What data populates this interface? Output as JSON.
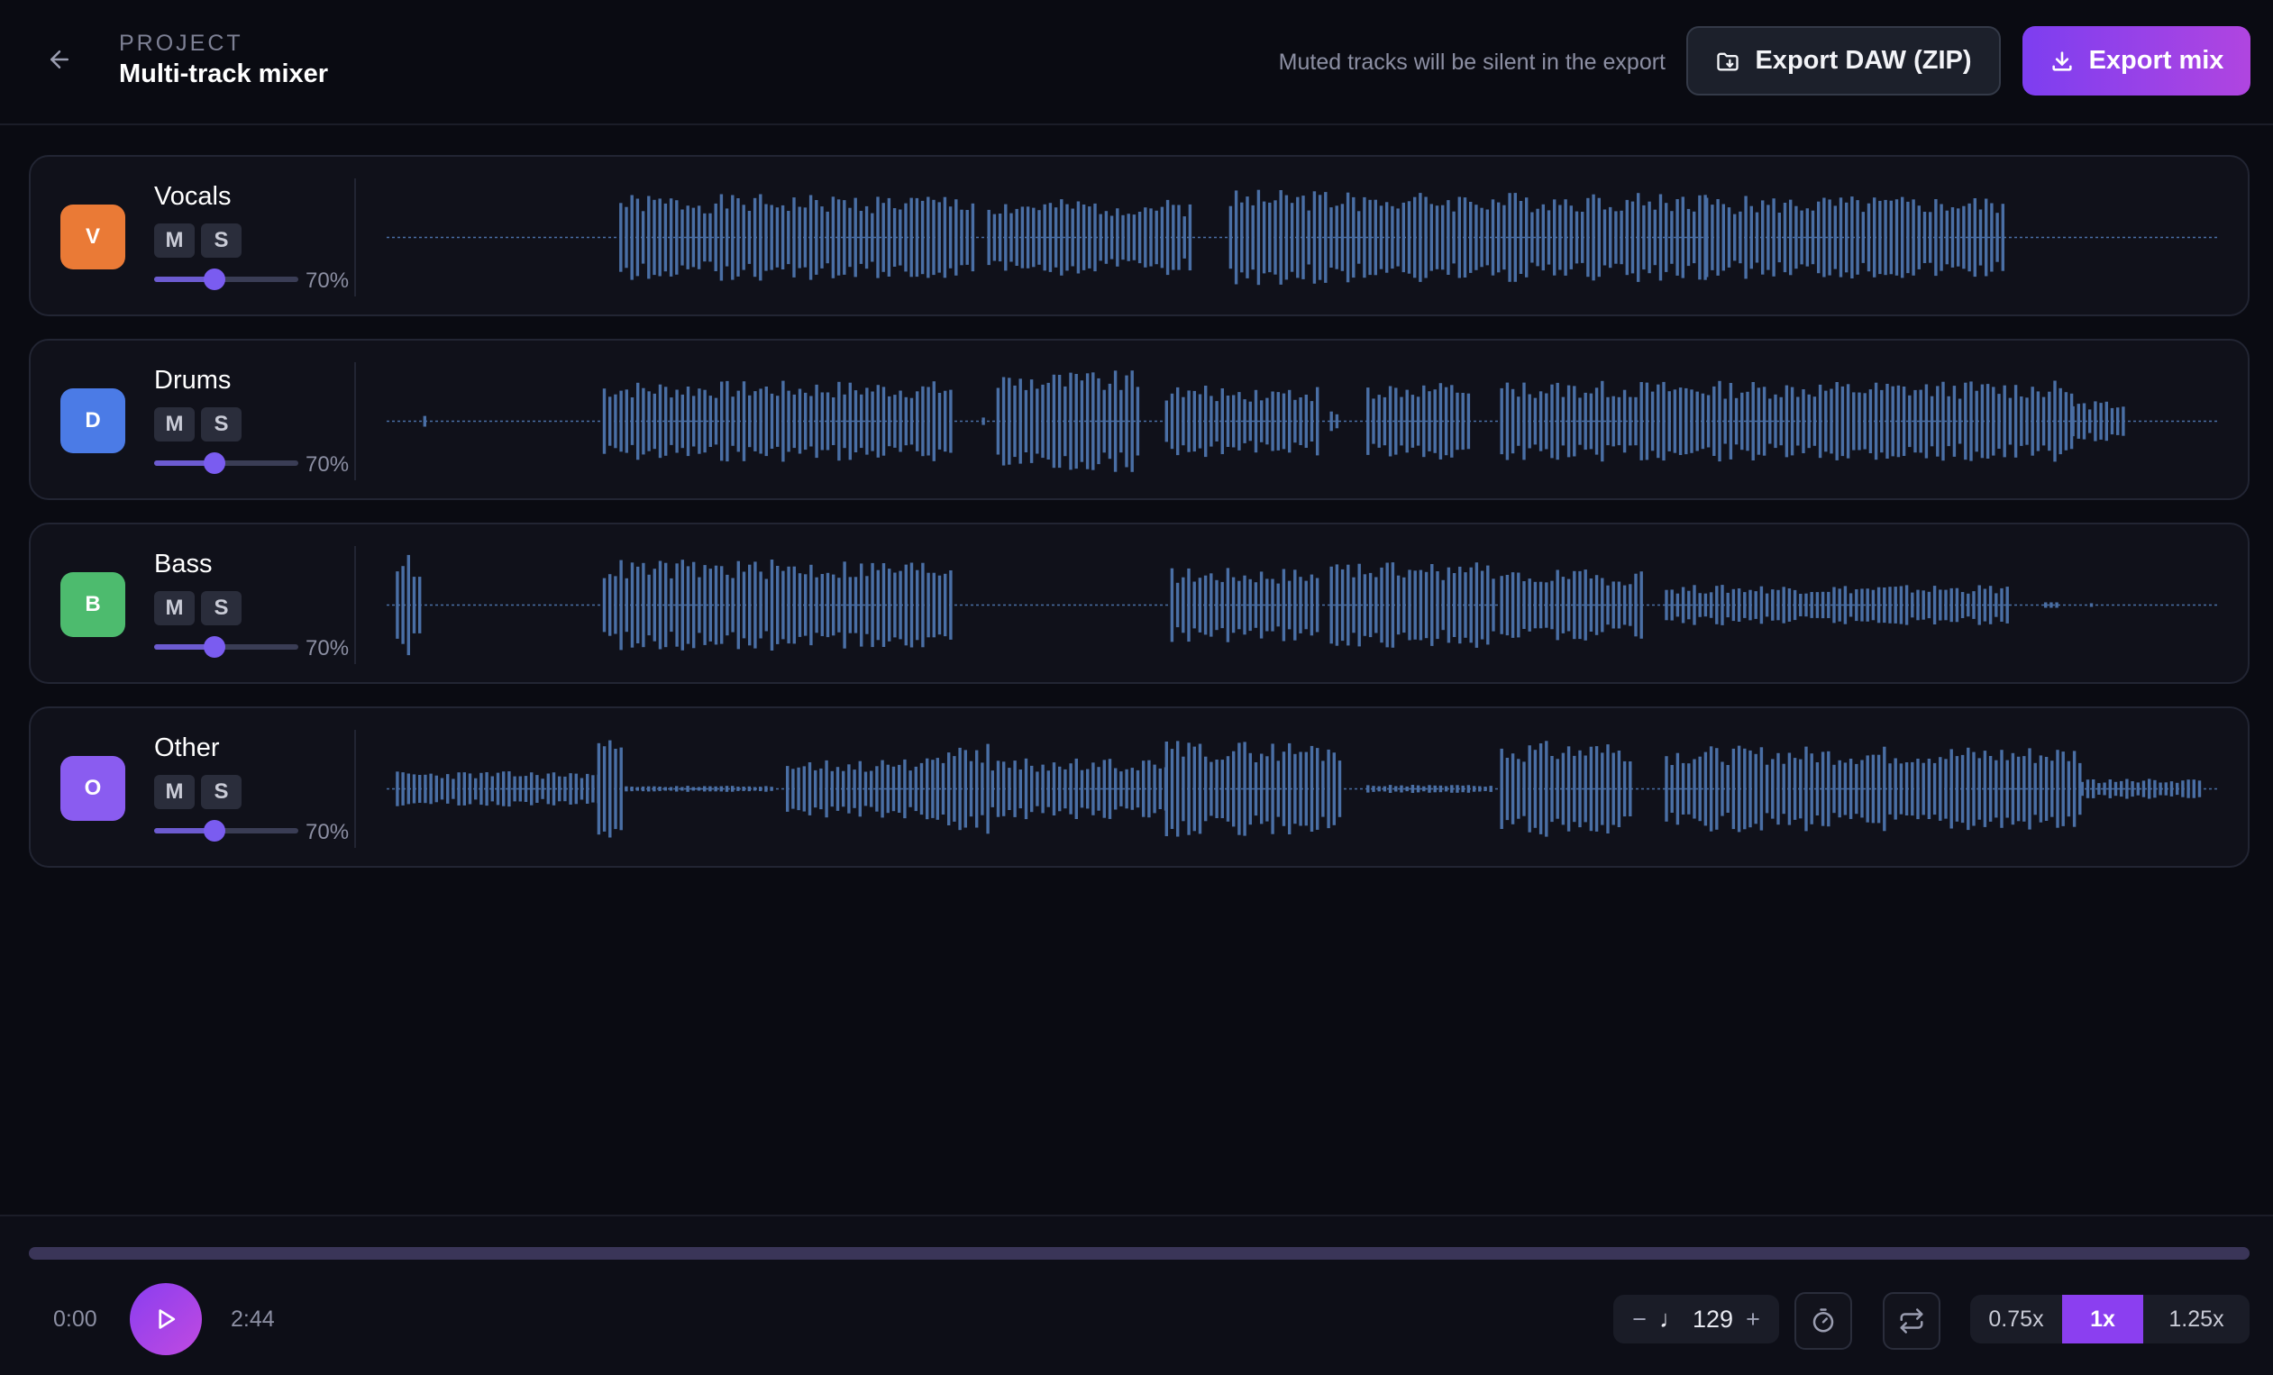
{
  "header": {
    "project_label": "PROJECT",
    "project_title": "Multi-track mixer",
    "export_note": "Muted tracks will be silent in the export",
    "export_daw_label": "Export DAW (ZIP)",
    "export_mix_label": "Export mix",
    "icons": {
      "back": "arrow-left-icon",
      "daw": "folder-download-icon",
      "mix": "download-icon"
    }
  },
  "tracks": [
    {
      "initial": "V",
      "name": "Vocals",
      "mute_label": "M",
      "solo_label": "S",
      "volume": 0.7,
      "volume_label": "70%",
      "color": "#ea7a36",
      "wave_color": "#4a6fa5",
      "segments": [
        [
          0.127,
          0.32,
          0.85,
          1
        ],
        [
          0.328,
          0.44,
          0.75,
          2
        ],
        [
          0.46,
          0.53,
          0.95,
          3
        ],
        [
          0.53,
          0.72,
          0.9,
          4
        ],
        [
          0.72,
          0.883,
          0.82,
          5
        ]
      ]
    },
    {
      "initial": "D",
      "name": "Drums",
      "mute_label": "M",
      "solo_label": "S",
      "volume": 0.7,
      "volume_label": "70%",
      "color": "#4b7be6",
      "wave_color": "#4a6fa5",
      "segments": [
        [
          0.02,
          0.022,
          0.12,
          6
        ],
        [
          0.118,
          0.31,
          0.8,
          7
        ],
        [
          0.325,
          0.328,
          0.1,
          8
        ],
        [
          0.333,
          0.41,
          1.0,
          9
        ],
        [
          0.425,
          0.51,
          0.7,
          10
        ],
        [
          0.515,
          0.52,
          0.2,
          11
        ],
        [
          0.535,
          0.59,
          0.75,
          12
        ],
        [
          0.608,
          0.92,
          0.8,
          13
        ],
        [
          0.92,
          0.95,
          0.4,
          14
        ]
      ]
    },
    {
      "initial": "B",
      "name": "Bass",
      "mute_label": "M",
      "solo_label": "S",
      "volume": 0.7,
      "volume_label": "70%",
      "color": "#4dbb6e",
      "wave_color": "#4a6fa5",
      "segments": [
        [
          0.005,
          0.02,
          1.0,
          15
        ],
        [
          0.118,
          0.31,
          0.9,
          16
        ],
        [
          0.428,
          0.51,
          0.75,
          17
        ],
        [
          0.515,
          0.605,
          0.85,
          18
        ],
        [
          0.608,
          0.685,
          0.7,
          19
        ],
        [
          0.698,
          0.885,
          0.4,
          20
        ],
        [
          0.905,
          0.912,
          0.08,
          21
        ],
        [
          0.93,
          0.932,
          0.06,
          22
        ]
      ]
    },
    {
      "initial": "O",
      "name": "Other",
      "mute_label": "M",
      "solo_label": "S",
      "volume": 0.7,
      "volume_label": "70%",
      "color": "#8a5cf0",
      "wave_color": "#4a6fa5",
      "segments": [
        [
          0.005,
          0.115,
          0.35,
          23
        ],
        [
          0.115,
          0.128,
          1.0,
          24
        ],
        [
          0.13,
          0.21,
          0.06,
          25
        ],
        [
          0.218,
          0.3,
          0.6,
          26
        ],
        [
          0.3,
          0.33,
          0.9,
          27
        ],
        [
          0.33,
          0.425,
          0.6,
          28
        ],
        [
          0.425,
          0.52,
          0.95,
          29
        ],
        [
          0.535,
          0.605,
          0.08,
          30
        ],
        [
          0.608,
          0.68,
          0.95,
          31
        ],
        [
          0.698,
          0.925,
          0.85,
          32
        ],
        [
          0.925,
          0.99,
          0.2,
          33
        ]
      ]
    }
  ],
  "transport": {
    "current_time": "0:00",
    "duration": "2:44",
    "progress": 0.0,
    "tempo_minus": "−",
    "tempo_plus": "+",
    "tempo_note": "♩",
    "tempo_value": "129",
    "speeds": [
      {
        "label": "0.75x",
        "active": false
      },
      {
        "label": "1x",
        "active": true
      },
      {
        "label": "1.25x",
        "active": false
      }
    ],
    "icons": {
      "play": "play-icon",
      "metronome": "stopwatch-icon",
      "loop": "loop-icon"
    }
  }
}
